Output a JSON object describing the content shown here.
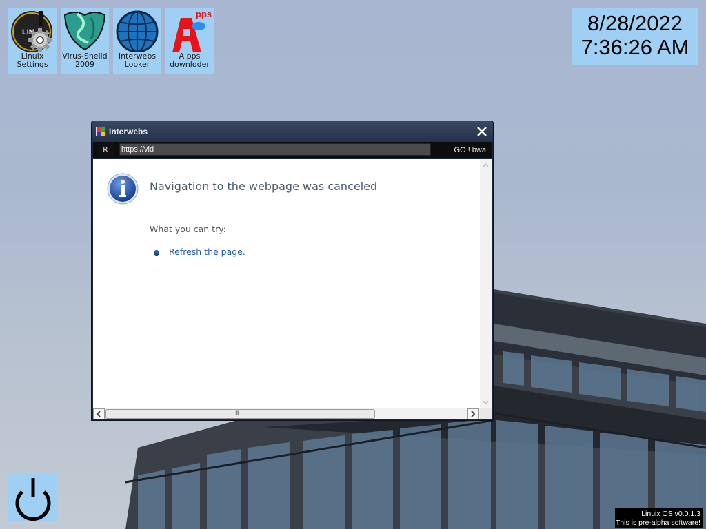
{
  "desktop_icons": [
    {
      "label_line1": "Linuix",
      "label_line2": "Settings",
      "icon": "gear-icon"
    },
    {
      "label_line1": "Virus-Sheild",
      "label_line2": "2009",
      "icon": "shield-icon"
    },
    {
      "label_line1": "Interwebs",
      "label_line2": "Looker",
      "icon": "globe-icon"
    },
    {
      "label_line1": "A pps",
      "label_line2": "downloder",
      "icon": "apps-icon",
      "badge": "pps"
    }
  ],
  "clock": {
    "date": "8/28/2022",
    "time": "7:36:26 AM"
  },
  "window": {
    "title": "Interwebs",
    "refresh_label": "R",
    "url_value": "https://vid",
    "go_label": "GO ! bwa",
    "page": {
      "heading": "Navigation to the webpage was canceled",
      "try_label": "What you can try:",
      "refresh_link": "Refresh the page."
    },
    "hscroll_grip": "III"
  },
  "version": {
    "line1": "Linuix OS v0.0.1.3",
    "line2": "This is pre-alpha software!"
  },
  "colors": {
    "tile": "#9fd0f3",
    "window_frame": "#1c2738",
    "link": "#2459a6"
  }
}
